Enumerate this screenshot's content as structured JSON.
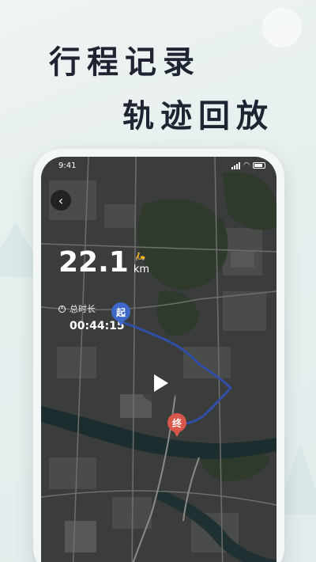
{
  "promo": {
    "headline_1": "行程记录",
    "headline_2": "轨迹回放"
  },
  "status_bar": {
    "time": "9:41"
  },
  "trip": {
    "distance_value": "22.1",
    "distance_unit": "km",
    "duration_label": "总时长",
    "duration_value": "00:44:15",
    "start_marker": "起",
    "end_marker": "终"
  },
  "icons": {
    "back": "back-arrow-icon",
    "vehicle": "scooter-icon",
    "clock": "clock-icon",
    "play": "play-icon"
  },
  "colors": {
    "route": "#2f4fa8",
    "start_pin": "#3d68c9",
    "end_pin": "#d9574a",
    "headline": "#1f2433"
  }
}
